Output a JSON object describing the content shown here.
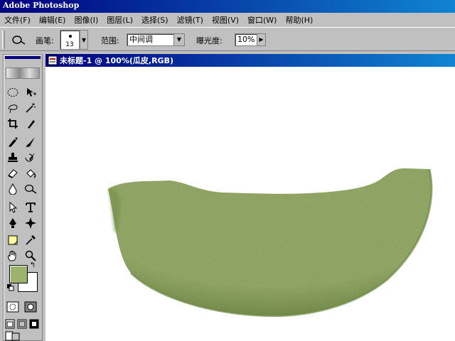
{
  "app": {
    "title": "Adobe Photoshop"
  },
  "menu": [
    "文件(F)",
    "编辑(E)",
    "图像(I)",
    "图层(L)",
    "选择(S)",
    "滤镜(T)",
    "视图(V)",
    "窗口(W)",
    "帮助(H)"
  ],
  "options": {
    "tool_icon": "dodge-icon",
    "brush_label": "画笔:",
    "brush_size": "13",
    "range_label": "范围:",
    "range_value": "中间调",
    "exposure_label": "曝光度:",
    "exposure_value": "10%"
  },
  "toolbox": {
    "tools": [
      "marquee",
      "move",
      "lasso",
      "magic-wand",
      "crop",
      "slice",
      "airbrush",
      "paintbrush",
      "rubber-stamp",
      "history-brush",
      "eraser",
      "paint-bucket",
      "blur",
      "dodge",
      "path-select",
      "type",
      "pen",
      "shape",
      "notes",
      "eyedropper",
      "hand",
      "zoom"
    ],
    "foreground_color": "#9cb36e",
    "background_color": "#ffffff"
  },
  "document": {
    "title": "未标题-1 @ 100%(瓜皮,RGB)",
    "shape_color": "#9cb36e",
    "shape_shadow_color": "#6f8a44"
  }
}
